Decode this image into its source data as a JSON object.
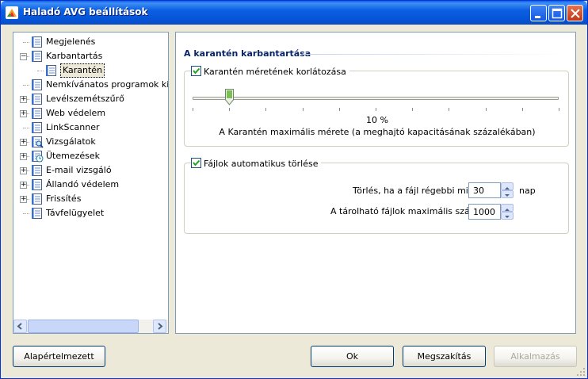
{
  "window": {
    "title": "Haladó AVG beállítások",
    "accent": "#0554d8",
    "icon": "avg-logo-icon"
  },
  "tree": {
    "items": [
      {
        "label": "Megjelenés",
        "icon": "document-list-icon",
        "expandable": false
      },
      {
        "label": "Karbantartás",
        "icon": "document-list-icon",
        "expandable": true,
        "expanded": true
      },
      {
        "label": "Karantén",
        "icon": "document-list-icon",
        "expandable": false,
        "selected": true
      },
      {
        "label": "Nemkívánatos programok kivéte",
        "icon": "document-list-icon",
        "expandable": false
      },
      {
        "label": "Levélszemétszűrő",
        "icon": "document-list-icon",
        "expandable": true
      },
      {
        "label": "Web védelem",
        "icon": "document-list-icon",
        "expandable": true
      },
      {
        "label": "LinkScanner",
        "icon": "document-list-icon",
        "expandable": false
      },
      {
        "label": "Vizsgálatok",
        "icon": "magnifier-document-icon",
        "expandable": true
      },
      {
        "label": "Ütemezések",
        "icon": "clock-document-icon",
        "expandable": true
      },
      {
        "label": "E-mail vizsgáló",
        "icon": "document-list-icon",
        "expandable": true
      },
      {
        "label": "Állandó védelem",
        "icon": "document-list-icon",
        "expandable": true
      },
      {
        "label": "Frissítés",
        "icon": "document-list-icon",
        "expandable": true
      },
      {
        "label": "Távfelügyelet",
        "icon": "document-list-icon",
        "expandable": false
      }
    ]
  },
  "content": {
    "section_title": "A karantén karbantartása",
    "size_limit": {
      "checkbox_label": "Karantén méretének korlátozása",
      "checked": true,
      "slider_value_percent": 10,
      "value_label": "10 %",
      "description": "A Karantén maximális mérete (a meghajtó kapacitásának százalékában)"
    },
    "auto_delete": {
      "checkbox_label": "Fájlok automatikus törlése",
      "checked": true,
      "older_than_label": "Törlés, ha a fájl régebbi mint",
      "older_than_value": "30",
      "older_than_unit": "nap",
      "max_files_label": "A tárolható fájlok maximális száma:",
      "max_files_value": "1000"
    }
  },
  "buttons": {
    "defaults": "Alapértelmezett",
    "ok": "Ok",
    "cancel": "Megszakítás",
    "apply": "Alkalmazás"
  }
}
